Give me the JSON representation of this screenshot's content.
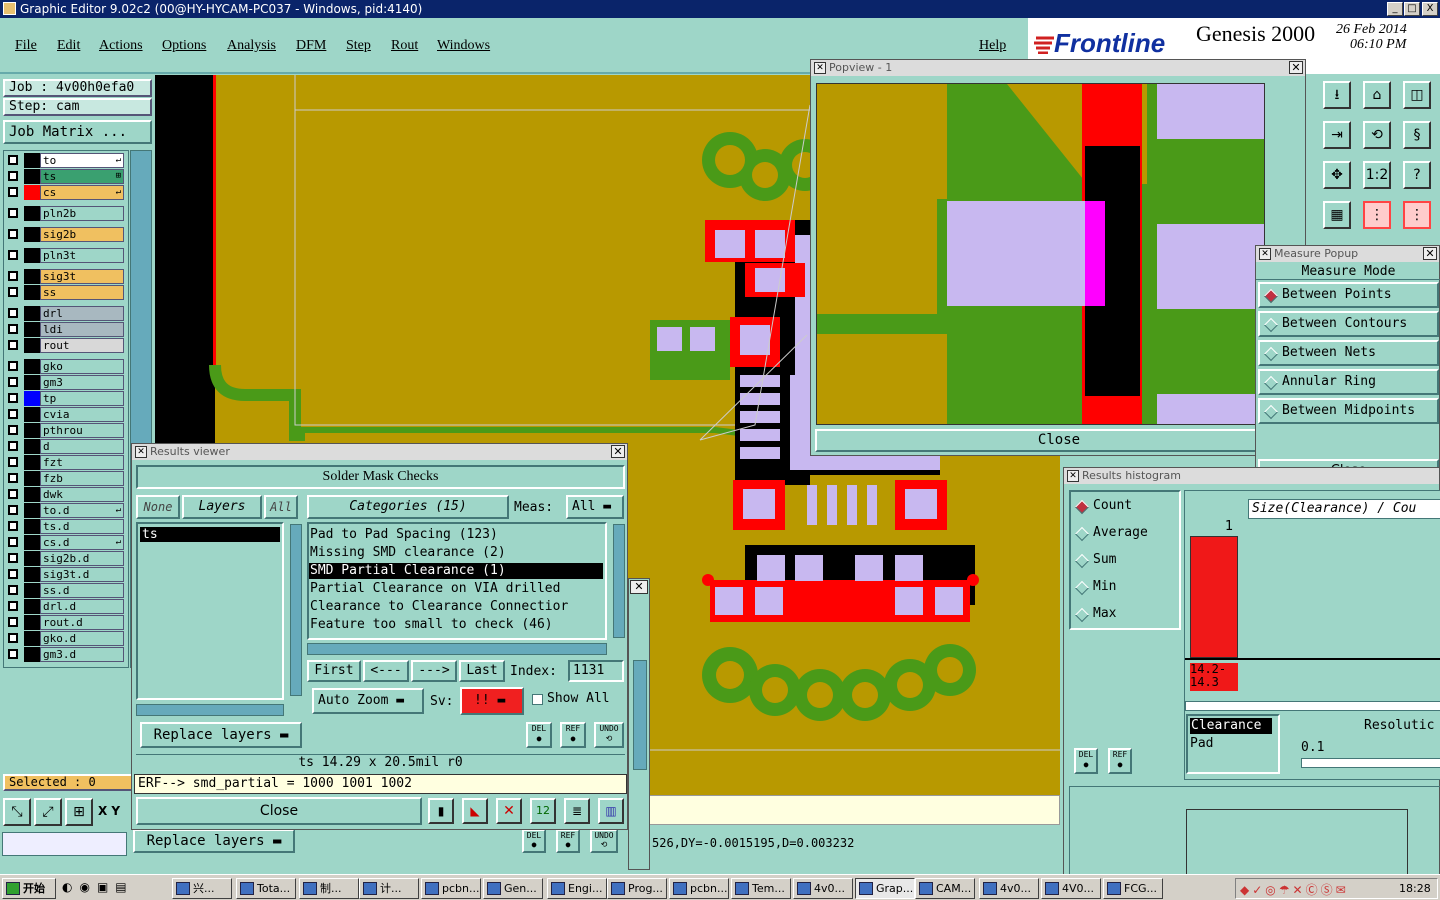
{
  "titlebar": {
    "title": "Graphic Editor 9.02c2 (00@HY-HYCAM-PC037 - Windows, pid:4140)",
    "min": "_",
    "max": "□",
    "close": "X"
  },
  "menu": {
    "items": [
      "File",
      "Edit",
      "Actions",
      "Options",
      "Analysis",
      "DFM",
      "Step",
      "Rout",
      "Windows"
    ],
    "help": "Help"
  },
  "brand": {
    "logo": "Frontline",
    "product": "Genesis 2000",
    "date": "26 Feb 2014",
    "time": "06:10 PM"
  },
  "job": {
    "job": "Job : 4v00h0efa0",
    "step": "Step: cam",
    "matrix": "Job Matrix ..."
  },
  "layers": [
    {
      "name": "to",
      "color": "#ffffff",
      "tag": "↵"
    },
    {
      "name": "ts",
      "color": "#3aa070",
      "tag": "⊞"
    },
    {
      "name": "cs",
      "color": "#f0c060",
      "tag": "↵"
    },
    {
      "name": "pln2b",
      "color": "#9ed6c8",
      "tag": ""
    },
    {
      "name": "sig2b",
      "color": "#f0c060",
      "tag": ""
    },
    {
      "name": "pln3t",
      "color": "#9ed6c8",
      "tag": ""
    },
    {
      "name": "sig3t",
      "color": "#f0c060",
      "tag": ""
    },
    {
      "name": "ss",
      "color": "#f0c060",
      "tag": ""
    },
    {
      "name": "drl",
      "color": "#a8b8c0",
      "tag": ""
    },
    {
      "name": "ldi",
      "color": "#a8b8c0",
      "tag": ""
    },
    {
      "name": "rout",
      "color": "#d8d8d8",
      "tag": ""
    },
    {
      "name": "gko",
      "color": "#9ed6c8",
      "tag": ""
    },
    {
      "name": "gm3",
      "color": "#9ed6c8",
      "tag": ""
    },
    {
      "name": "tp",
      "color": "#9ed6c8",
      "tag": ""
    },
    {
      "name": "cvia",
      "color": "#9ed6c8",
      "tag": ""
    },
    {
      "name": "pthrou",
      "color": "#9ed6c8",
      "tag": ""
    },
    {
      "name": "d",
      "color": "#9ed6c8",
      "tag": ""
    },
    {
      "name": "fzt",
      "color": "#9ed6c8",
      "tag": ""
    },
    {
      "name": "fzb",
      "color": "#9ed6c8",
      "tag": ""
    },
    {
      "name": "dwk",
      "color": "#9ed6c8",
      "tag": ""
    },
    {
      "name": "to.d",
      "color": "#9ed6c8",
      "tag": "↵"
    },
    {
      "name": "ts.d",
      "color": "#9ed6c8",
      "tag": ""
    },
    {
      "name": "cs.d",
      "color": "#9ed6c8",
      "tag": "↵"
    },
    {
      "name": "sig2b.d",
      "color": "#9ed6c8",
      "tag": ""
    },
    {
      "name": "sig3t.d",
      "color": "#9ed6c8",
      "tag": ""
    },
    {
      "name": "ss.d",
      "color": "#9ed6c8",
      "tag": ""
    },
    {
      "name": "drl.d",
      "color": "#9ed6c8",
      "tag": ""
    },
    {
      "name": "rout.d",
      "color": "#9ed6c8",
      "tag": ""
    },
    {
      "name": "gko.d",
      "color": "#9ed6c8",
      "tag": ""
    },
    {
      "name": "gm3.d",
      "color": "#9ed6c8",
      "tag": ""
    }
  ],
  "selected": "Selected : 0",
  "xy": "X Y",
  "popview": {
    "title": "Popview - 1",
    "close": "Close"
  },
  "measure": {
    "title": "Measure Popup",
    "heading": "Measure Mode",
    "options": [
      "Between Points",
      "Between Contours",
      "Between Nets",
      "Annular Ring",
      "Between Midpoints"
    ],
    "selected": "Between Points",
    "close": "Close"
  },
  "results": {
    "title": "Results viewer",
    "heading": "Solder Mask Checks",
    "none": "None",
    "layers": "Layers",
    "all": "All",
    "categories": "Categories (15)",
    "meas_label": "Meas:",
    "meas_value": "All",
    "layer_list": [
      "ts"
    ],
    "cat_list": [
      "Pad to Pad Spacing (123)",
      "Missing SMD clearance (2)",
      "SMD Partial Clearance (1)",
      "Partial Clearance on VIA drilled",
      "Clearance to Clearance Connectior",
      "Feature too small to check (46)"
    ],
    "selected_cat": "SMD Partial Clearance (1)",
    "first": "First",
    "prev": "<---",
    "next": "--->",
    "last": "Last",
    "index_label": "Index:",
    "index_value": "1131",
    "autozoom": "Auto Zoom",
    "sv_label": "Sv:",
    "sv_value": "!!",
    "showall": "Show All",
    "replace": "Replace layers",
    "del": "DEL",
    "ref": "REF",
    "undo": "UNDO",
    "info": "ts 14.29 x 20.5mil r0",
    "erf": "ERF--> smd_partial = 1000 1001 1002",
    "close": "Close"
  },
  "status": {
    "replace": "Replace layers",
    "coords": "526,DY=-0.0015195,D=0.003232"
  },
  "histogram": {
    "title": "Results histogram",
    "options": [
      "Count",
      "Average",
      "Sum",
      "Min",
      "Max"
    ],
    "selected": "Count",
    "axis_title": "Size(Clearance) / Cou",
    "bar_count": "1",
    "bin_label": "14.2- 14.3",
    "list": [
      "Clearance",
      "Pad"
    ],
    "resolution_label": "Resolutic",
    "resolution_value": "0.1",
    "del": "DEL",
    "ref": "REF"
  },
  "taskbar": {
    "start": "开始",
    "tasks": [
      "兴...",
      "Tota...",
      "制...",
      "计...",
      "pcbn...",
      "Gen...",
      "Engi...",
      "Prog...",
      "pcbn...",
      "Tem...",
      "4v0...",
      "Grap...",
      "CAM...",
      "4v0...",
      "4V0...",
      "FCG..."
    ],
    "active": "Grap...",
    "clock": "18:28"
  },
  "colors": {
    "copper": "#b89900",
    "mask": "#4a9a18",
    "clear": "#ff0000",
    "pad": "#c8b8f0",
    "bg": "#9ed6c8"
  }
}
